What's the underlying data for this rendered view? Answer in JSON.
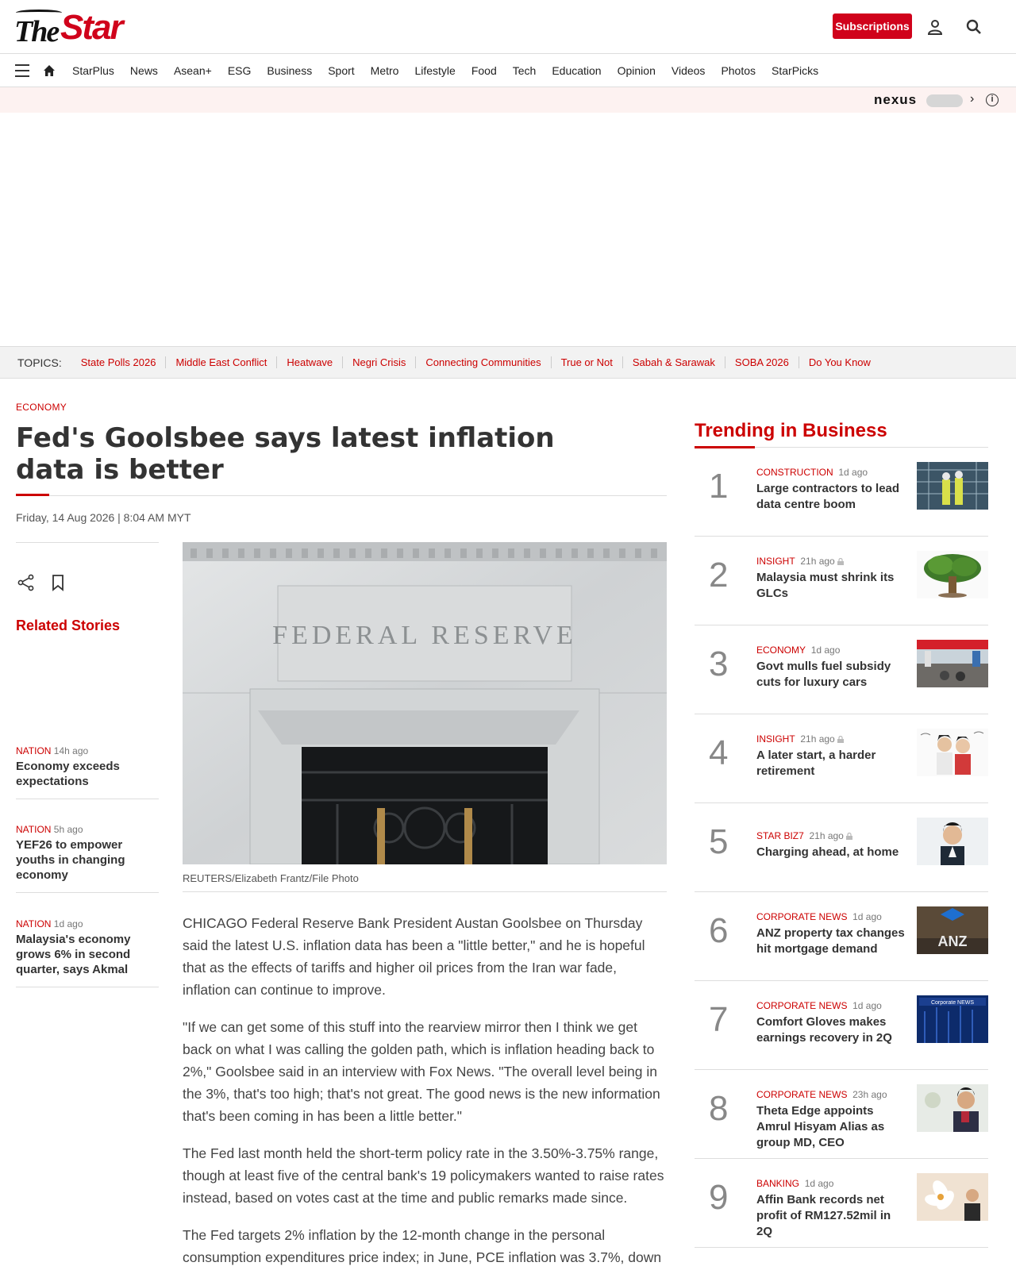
{
  "header": {
    "logo_text_the": "The",
    "logo_text_star": "Star",
    "subscribe_label": "Subscriptions"
  },
  "nav": {
    "items": [
      "StarPlus",
      "News",
      "Asean+",
      "ESG",
      "Business",
      "Sport",
      "Metro",
      "Lifestyle",
      "Food",
      "Tech",
      "Education",
      "Opinion",
      "Videos",
      "Photos",
      "StarPicks"
    ]
  },
  "nexus": {
    "label": "nexus",
    "chevron": "›",
    "info": "i"
  },
  "topics": {
    "label": "TOPICS:",
    "items": [
      "State Polls 2026",
      "Middle East Conflict",
      "Heatwave",
      "Negri Crisis",
      "Connecting Communities",
      "True or Not",
      "Sabah & Sarawak",
      "SOBA 2026",
      "Do You Know"
    ]
  },
  "article": {
    "category": "ECONOMY",
    "title": "Fed's Goolsbee says latest inflation data is better",
    "date": "Friday, 14 Aug 2026 | 8:04 AM MYT",
    "photo_engraving": "FEDERAL RESERVE",
    "caption": "REUTERS/Elizabeth Frantz/File Photo",
    "paragraphs": [
      "CHICAGO Federal Reserve Bank President Austan Goolsbee on Thursday said the latest U.S. inflation data has been a \"little better,\" and he is hopeful that as the effects of tariffs and higher oil prices from the Iran war fade, inflation can continue to improve.",
      "\"If we can get some of this stuff into the rearview mirror then I think we get back on what I was calling the golden path, which is inflation heading back to 2%,\" Goolsbee said in an interview with Fox News. \"The overall level being in the 3%, that's too high; that's not great. The good news is the new information that's been coming in has been a little better.\"",
      "The Fed last month held the short-term policy rate in the 3.50%-3.75% range, though at least five of the central bank's 19 policymakers wanted to raise rates instead, based on votes cast at the time and public remarks made since.",
      "The Fed targets 2% inflation by the 12-month change in the personal consumption expenditures price index; in June, PCE inflation was 3.7%, down"
    ]
  },
  "related": {
    "heading": "Related Stories",
    "items": [
      {
        "category": "NATION",
        "time": "14h ago",
        "title": "Economy exceeds expectations"
      },
      {
        "category": "NATION",
        "time": "5h ago",
        "title": "YEF26 to empower youths in changing economy"
      },
      {
        "category": "NATION",
        "time": "1d ago",
        "title": "Malaysia's economy grows 6% in second quarter, says Akmal"
      }
    ]
  },
  "trending": {
    "heading": "Trending in Business",
    "items": [
      {
        "rank": "1",
        "category": "CONSTRUCTION",
        "time": "1d ago",
        "title": "Large contractors to lead data centre boom",
        "locked": false
      },
      {
        "rank": "2",
        "category": "INSIGHT",
        "time": "21h ago",
        "title": "Malaysia must shrink its GLCs",
        "locked": true
      },
      {
        "rank": "3",
        "category": "ECONOMY",
        "time": "1d ago",
        "title": "Govt mulls fuel subsidy cuts for luxury cars",
        "locked": false
      },
      {
        "rank": "4",
        "category": "INSIGHT",
        "time": "21h ago",
        "title": "A later start, a harder retirement",
        "locked": true
      },
      {
        "rank": "5",
        "category": "STAR BIZ7",
        "time": "21h ago",
        "title": "Charging ahead, at home",
        "locked": true
      },
      {
        "rank": "6",
        "category": "CORPORATE NEWS",
        "time": "1d ago",
        "title": "ANZ property tax changes hit mortgage demand",
        "locked": false
      },
      {
        "rank": "7",
        "category": "CORPORATE NEWS",
        "time": "1d ago",
        "title": "Comfort Gloves makes earnings recovery in 2Q",
        "locked": false
      },
      {
        "rank": "8",
        "category": "CORPORATE NEWS",
        "time": "23h ago",
        "title": "Theta Edge appoints Amrul Hisyam Alias as group MD, CEO",
        "locked": false
      },
      {
        "rank": "9",
        "category": "BANKING",
        "time": "1d ago",
        "title": "Affin Bank records net profit of RM127.52mil in 2Q",
        "locked": false
      }
    ],
    "thumb_texts": {
      "anz": "ANZ",
      "corp": "Corporate NEWS"
    }
  },
  "colors": {
    "brand": "#d0021b",
    "link": "#cc0000",
    "nexus_bg": "#fdf2f1"
  }
}
